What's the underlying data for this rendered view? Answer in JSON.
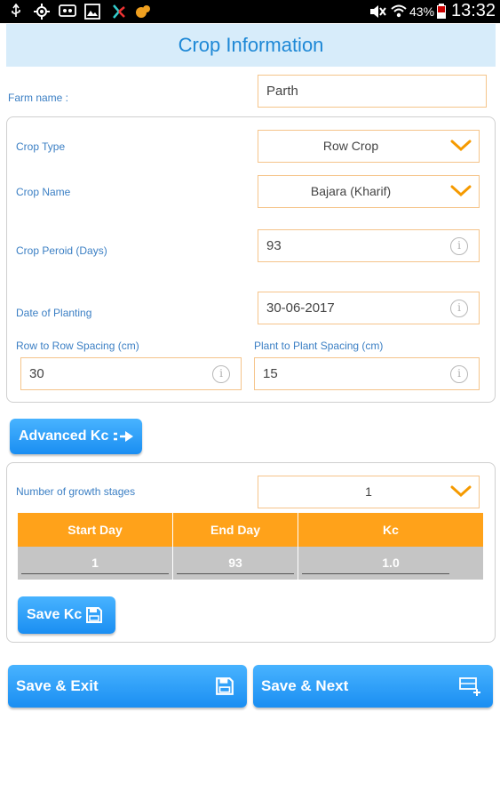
{
  "status_bar": {
    "left_icons": [
      "usb-icon",
      "gps-icon",
      "voicemail-icon",
      "image-icon",
      "app-icon",
      "squirrel-app-icon"
    ],
    "right_icons": [
      "mute-icon",
      "wifi-icon",
      "battery-icon"
    ],
    "battery": "43%",
    "time": "13:32"
  },
  "header": {
    "title": "Crop Information"
  },
  "farm": {
    "label": "Farm name :",
    "value": "Parth"
  },
  "crop": {
    "type_label": "Crop Type",
    "type_value": "Row Crop",
    "name_label": "Crop Name",
    "name_value": "Bajara (Kharif)",
    "period_label": "Crop Peroid (Days)",
    "period_value": "93",
    "planting_label": "Date of Planting",
    "planting_value": "30-06-2017",
    "row_spacing_label": "Row to Row Spacing (cm)",
    "row_spacing_value": "30",
    "plant_spacing_label": "Plant to Plant Spacing (cm)",
    "plant_spacing_value": "15"
  },
  "advanced_button": {
    "label": "Advanced Kc",
    "icon": "arrow-right-icon"
  },
  "growth": {
    "label": "Number of growth stages",
    "value": "1",
    "table": {
      "headers": [
        "Start Day",
        "End Day",
        "Kc"
      ],
      "rows": [
        [
          "1",
          "93",
          "1.0"
        ]
      ]
    },
    "save_button": {
      "label": "Save Kc",
      "icon": "save-icon"
    }
  },
  "footer": {
    "save_exit": {
      "label": "Save & Exit",
      "icon": "save-icon"
    },
    "save_next": {
      "label": "Save & Next",
      "icon": "add-row-icon"
    }
  },
  "colors": {
    "accent": "#1e88d6",
    "button": "#2196f3",
    "field_border": "#f5c48a",
    "table_header": "#ffa21a",
    "table_row": "#c5c5c5",
    "chevron": "#f59a00"
  }
}
